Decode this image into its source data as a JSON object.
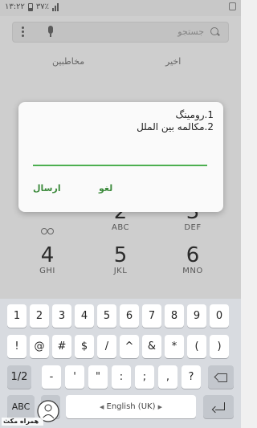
{
  "status_bar": {
    "time": "۱۳:۲۲",
    "battery": "۳۷٪"
  },
  "search": {
    "placeholder": "جستجو"
  },
  "tabs": {
    "recent": "اخیر",
    "contacts": "مخاطبین"
  },
  "dialpad": [
    {
      "digit": "2",
      "sub": "ABC"
    },
    {
      "digit": "3",
      "sub": "DEF"
    },
    {
      "digit": "4",
      "sub": "GHI"
    },
    {
      "digit": "5",
      "sub": "JKL"
    },
    {
      "digit": "6",
      "sub": "MNO"
    }
  ],
  "dialog": {
    "line1": "1.رومینگ",
    "line2": "2.مکالمه بین الملل",
    "input_value": "",
    "send_label": "ارسال",
    "cancel_label": "لغو"
  },
  "keyboard": {
    "row1": [
      "1",
      "2",
      "3",
      "4",
      "5",
      "6",
      "7",
      "8",
      "9",
      "0"
    ],
    "row2": [
      "!",
      "@",
      "#",
      "$",
      "/",
      "^",
      "&",
      "*",
      "(",
      ")"
    ],
    "row3_toggle": "1/2",
    "row3": [
      "-",
      "'",
      "\"",
      ":",
      ";",
      ",",
      "?"
    ],
    "abc_label": "ABC",
    "space_label": "English (UK)"
  },
  "watermark": {
    "text": "همراه مکث"
  },
  "colors": {
    "accent": "#4caf50",
    "button_text": "#3d8b3d",
    "keyboard_bg": "#d8dbe0"
  }
}
